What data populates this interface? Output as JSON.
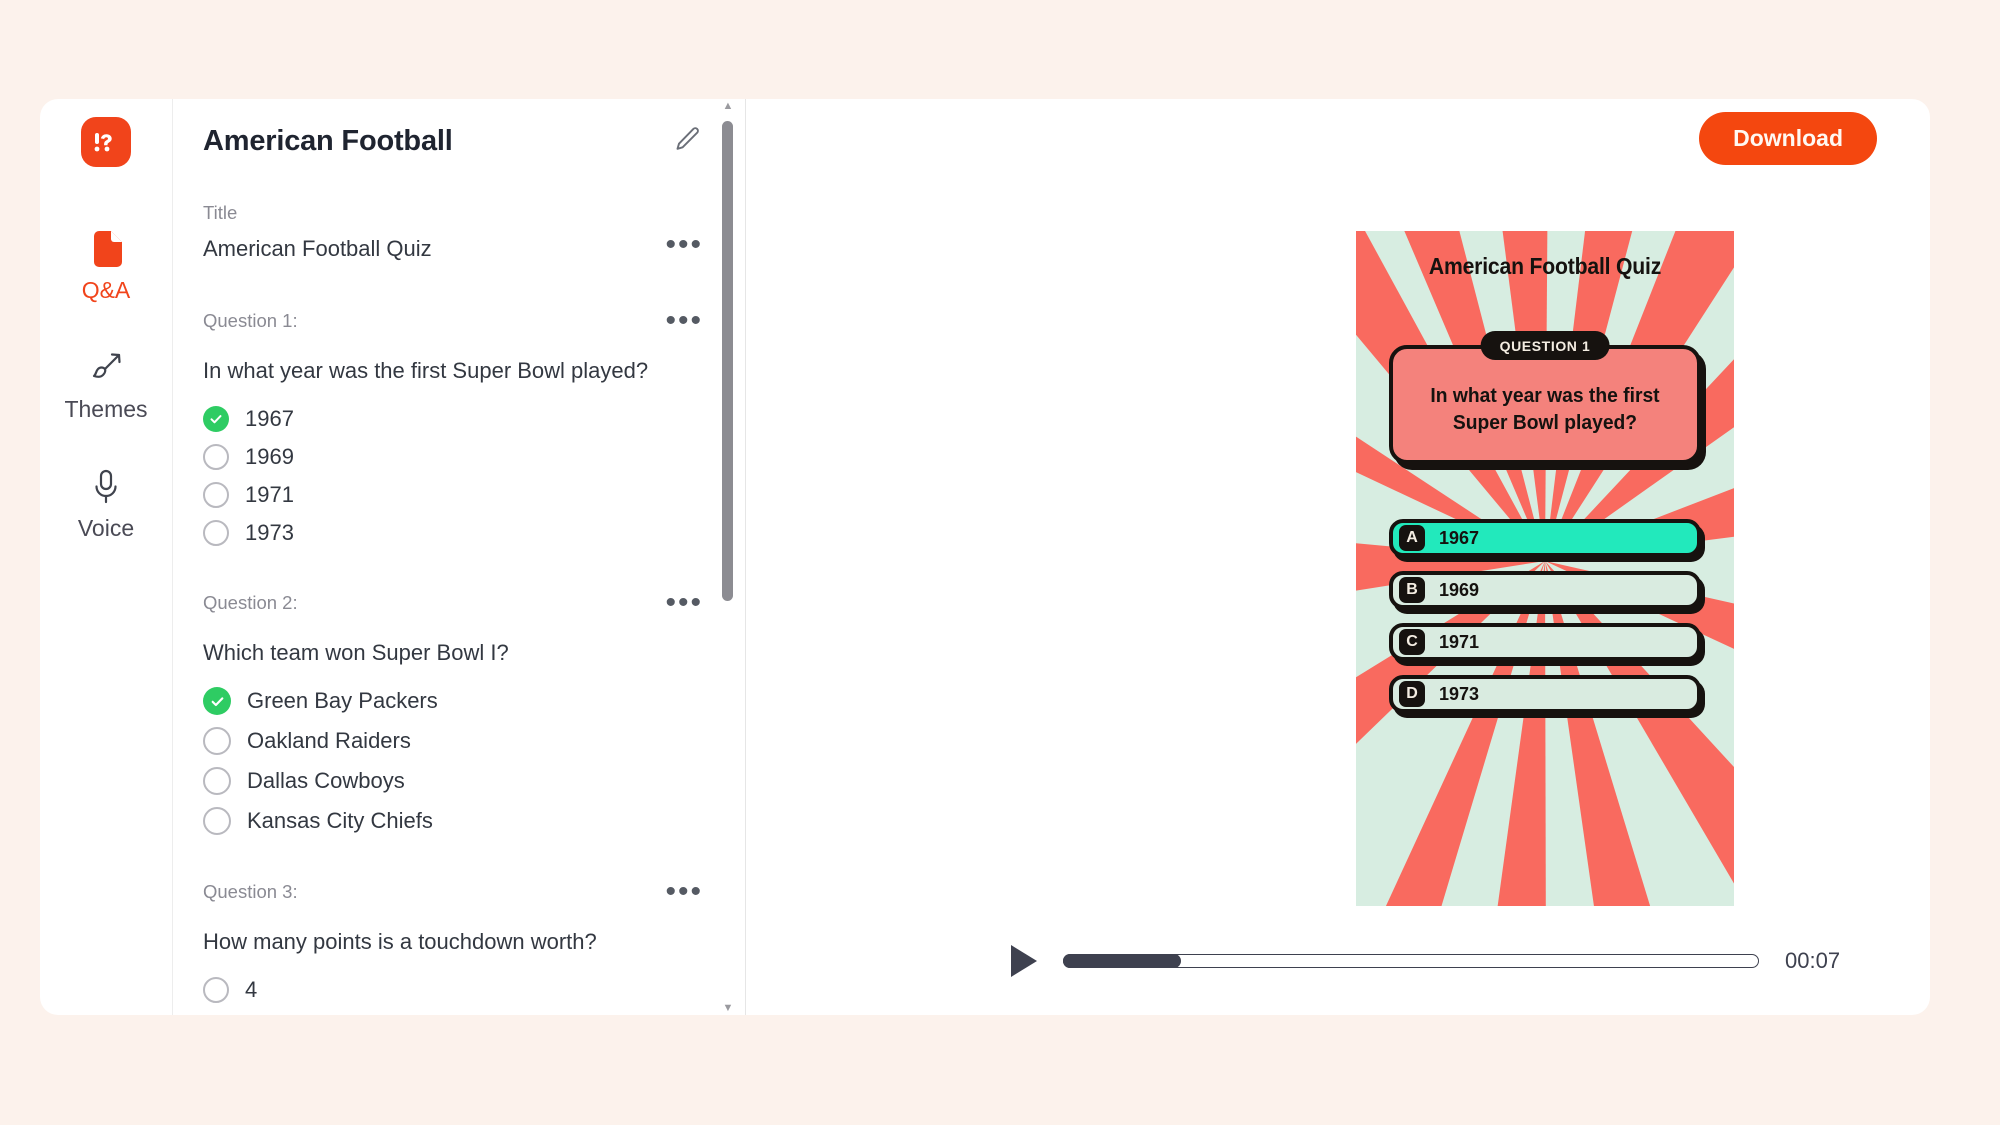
{
  "page": {
    "background_color": "#FCF2EC",
    "card_background": "#FFFFFF"
  },
  "brand": {
    "accent_color": "#F1441B",
    "logo_icon": "exclamation-question-logo-icon",
    "logo_glyph": "!?"
  },
  "sidebar": {
    "items": [
      {
        "label": "Q&A",
        "icon": "document-icon",
        "active": true
      },
      {
        "label": "Themes",
        "icon": "paintbrush-icon",
        "active": false
      },
      {
        "label": "Voice",
        "icon": "microphone-icon",
        "active": false
      }
    ]
  },
  "editor": {
    "header_title": "American Football",
    "edit_icon": "pencil-icon",
    "menu_icon": "ellipsis-icon",
    "title_field": {
      "label": "Title",
      "value": "American Football Quiz"
    },
    "questions": [
      {
        "label": "Question 1:",
        "text": "In what year was the first Super Bowl played?",
        "options": [
          {
            "text": "1967",
            "correct": true
          },
          {
            "text": "1969",
            "correct": false
          },
          {
            "text": "1971",
            "correct": false
          },
          {
            "text": "1973",
            "correct": false
          }
        ]
      },
      {
        "label": "Question 2:",
        "text": "Which team won Super Bowl I?",
        "options": [
          {
            "text": "Green Bay Packers",
            "correct": true
          },
          {
            "text": "Oakland Raiders",
            "correct": false
          },
          {
            "text": "Dallas Cowboys",
            "correct": false
          },
          {
            "text": "Kansas City Chiefs",
            "correct": false
          }
        ]
      },
      {
        "label": "Question 3:",
        "text": "How many points is a touchdown worth?",
        "options": [
          {
            "text": "4",
            "correct": false
          }
        ]
      }
    ],
    "scrollbar": {
      "up_arrow": "▲",
      "down_arrow": "▼"
    },
    "correct_color": "#2ECC63",
    "radio_border_color": "#B9B9BF"
  },
  "preview": {
    "download_label": "Download",
    "download_color": "#F4470F",
    "slide": {
      "title": "American Football Quiz",
      "question_badge": "QUESTION 1",
      "question_text_line1": "In what year was the first",
      "question_text_line2": "Super Bowl played?",
      "background_color": "#D7EDE1",
      "ray_color": "#F96A5F",
      "question_card_color": "#F4827C",
      "correct_answer_color": "#22E9BC",
      "answer_color": "#D9EBE0",
      "outline_color": "#16120F",
      "answers": [
        {
          "letter": "A",
          "text": "1967",
          "correct": true
        },
        {
          "letter": "B",
          "text": "1969",
          "correct": false
        },
        {
          "letter": "C",
          "text": "1971",
          "correct": false
        },
        {
          "letter": "D",
          "text": "1973",
          "correct": false
        }
      ]
    },
    "player": {
      "play_icon": "play-icon",
      "elapsed_time": "00:07",
      "progress_percent": 17
    }
  }
}
